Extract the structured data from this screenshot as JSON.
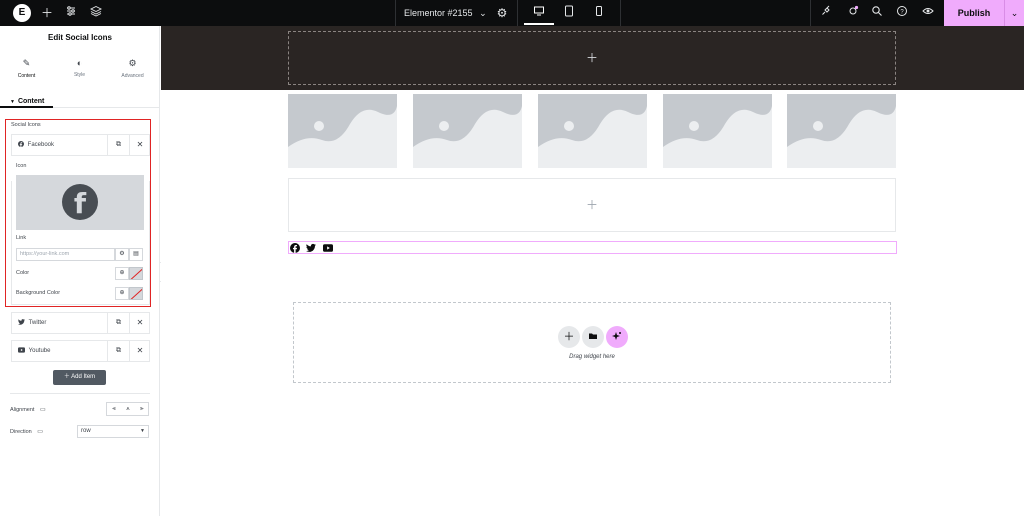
{
  "topbar": {
    "logo": "E",
    "document_title": "Elementor #2155",
    "publish_label": "Publish"
  },
  "panel": {
    "title": "Edit Social Icons",
    "tabs": [
      {
        "label": "Content",
        "icon": "pencil-icon"
      },
      {
        "label": "Style",
        "icon": "half-circle-icon"
      },
      {
        "label": "Advanced",
        "icon": "gear-icon"
      }
    ],
    "section_title": "Content",
    "repeater_label": "Social Icons",
    "items": [
      {
        "label": "Facebook",
        "icon": "facebook-icon"
      },
      {
        "label": "Twitter",
        "icon": "twitter-icon"
      },
      {
        "label": "Youtube",
        "icon": "youtube-icon"
      }
    ],
    "icon_label": "Icon",
    "link_label": "Link",
    "link_placeholder": "https://your-link.com",
    "color_label": "Color",
    "bg_color_label": "Background Color",
    "add_item_label": "Add Item",
    "alignment_label": "Alignment",
    "direction_label": "Direction",
    "direction_value": "row"
  },
  "canvas": {
    "drop_text": "Drag widget here"
  },
  "colors": {
    "accent": "#f0abfc",
    "topbar": "#0c0d0e",
    "highlight": "#e02424",
    "dark_section": "#2a2523"
  }
}
